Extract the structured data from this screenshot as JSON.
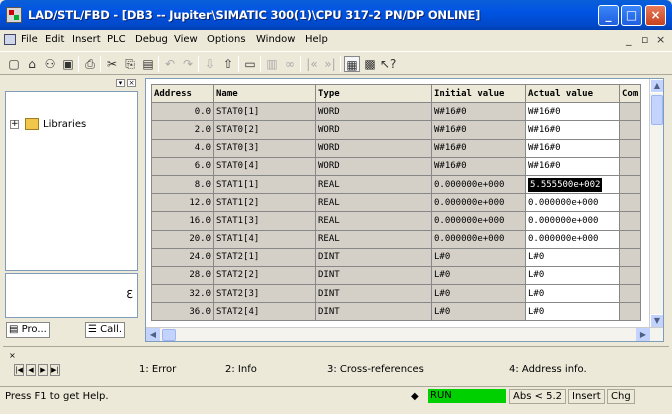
{
  "window": {
    "title": "LAD/STL/FBD  - [DB3 -- Jupiter\\SIMATIC 300(1)\\CPU 317-2 PN/DP  ONLINE]",
    "controls": [
      "minimize-icon",
      "maximize-icon",
      "close-icon"
    ]
  },
  "menubar": {
    "items": [
      "File",
      "Edit",
      "Insert",
      "PLC",
      "Debug",
      "View",
      "Options",
      "Window",
      "Help"
    ],
    "mdi_minimize": "_",
    "mdi_restore": "▫",
    "mdi_close": "×"
  },
  "toolbar": {
    "icons": [
      "new-icon",
      "open-icon",
      "network-icon",
      "save-icon",
      "print-icon",
      "cut-icon",
      "copy-icon",
      "paste-icon",
      "undo-icon",
      "redo-icon",
      "download-icon",
      "upload-icon",
      "overview-icon",
      "monitor-icon",
      "glasses-icon",
      "prev-icon",
      "next-icon",
      "detail-view-icon",
      "data-view-icon",
      "help-pointer-icon"
    ]
  },
  "leftpane": {
    "tree_items": [
      {
        "label": "Libraries"
      }
    ],
    "tabs": [
      {
        "label": "Pro..."
      },
      {
        "label": "Call."
      }
    ]
  },
  "table": {
    "columns": [
      "Address",
      "Name",
      "Type",
      "Initial value",
      "Actual value",
      "Com"
    ],
    "rows": [
      {
        "address": "0.0",
        "name": "STAT0[1]",
        "type": "WORD",
        "initial": "W#16#0",
        "actual": "W#16#0"
      },
      {
        "address": "2.0",
        "name": "STAT0[2]",
        "type": "WORD",
        "initial": "W#16#0",
        "actual": "W#16#0"
      },
      {
        "address": "4.0",
        "name": "STAT0[3]",
        "type": "WORD",
        "initial": "W#16#0",
        "actual": "W#16#0"
      },
      {
        "address": "6.0",
        "name": "STAT0[4]",
        "type": "WORD",
        "initial": "W#16#0",
        "actual": "W#16#0"
      },
      {
        "address": "8.0",
        "name": "STAT1[1]",
        "type": "REAL",
        "initial": "0.000000e+000",
        "actual": "5.555500e+002"
      },
      {
        "address": "12.0",
        "name": "STAT1[2]",
        "type": "REAL",
        "initial": "0.000000e+000",
        "actual": "0.000000e+000"
      },
      {
        "address": "16.0",
        "name": "STAT1[3]",
        "type": "REAL",
        "initial": "0.000000e+000",
        "actual": "0.000000e+000"
      },
      {
        "address": "20.0",
        "name": "STAT1[4]",
        "type": "REAL",
        "initial": "0.000000e+000",
        "actual": "0.000000e+000"
      },
      {
        "address": "24.0",
        "name": "STAT2[1]",
        "type": "DINT",
        "initial": "L#0",
        "actual": "L#0"
      },
      {
        "address": "28.0",
        "name": "STAT2[2]",
        "type": "DINT",
        "initial": "L#0",
        "actual": "L#0"
      },
      {
        "address": "32.0",
        "name": "STAT2[3]",
        "type": "DINT",
        "initial": "L#0",
        "actual": "L#0"
      },
      {
        "address": "36.0",
        "name": "STAT2[4]",
        "type": "DINT",
        "initial": "L#0",
        "actual": "L#0"
      }
    ]
  },
  "output_tabs": [
    "1: Error",
    "2: Info",
    "3: Cross-references",
    "4: Address info."
  ],
  "statusbar": {
    "help": "Press F1 to get Help.",
    "mode": "RUN",
    "mode_color": "#00d000",
    "abs": "Abs < 5.2",
    "insert": "Insert",
    "chg": "Chg"
  }
}
